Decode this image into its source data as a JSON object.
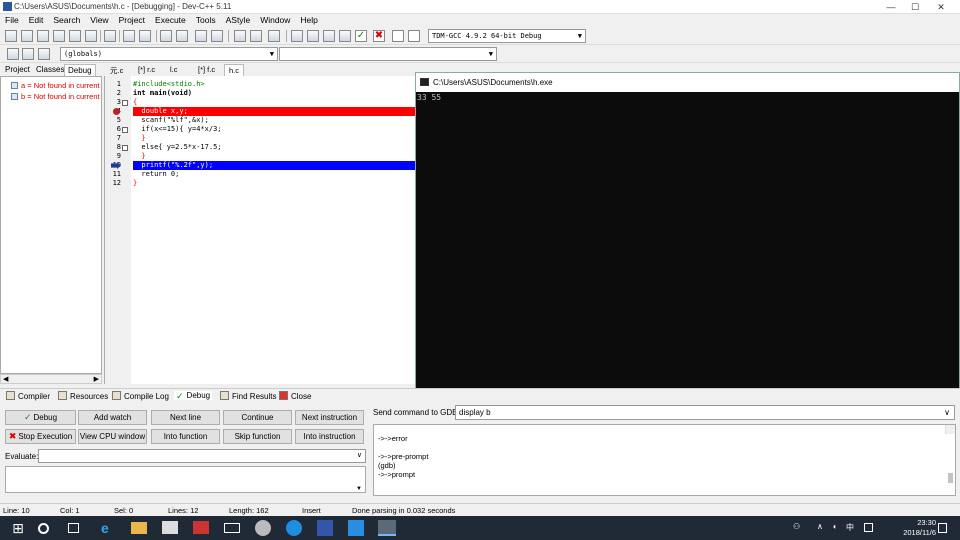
{
  "window": {
    "title": "C:\\Users\\ASUS\\Documents\\h.c - [Debugging] - Dev-C++ 5.11",
    "minimize": "—",
    "maximize": "☐",
    "close": "✕"
  },
  "menu": [
    "File",
    "Edit",
    "Search",
    "View",
    "Project",
    "Execute",
    "Tools",
    "AStyle",
    "Window",
    "Help"
  ],
  "toolbar": {
    "compiler_select": "TDM-GCC 4.9.2 64-bit Debug",
    "scope_select": "(globals)"
  },
  "left_tabs": [
    "Project",
    "Classes",
    "Debug"
  ],
  "watches": [
    {
      "text": "a = Not found in current context"
    },
    {
      "text": "b = Not found in current context"
    }
  ],
  "editor_tabs": [
    "元.c",
    "[*] r.c",
    "l.c",
    "[*] f.c",
    "h.c"
  ],
  "code_lines": [
    {
      "n": "1",
      "text": "#include<stdio.h>"
    },
    {
      "n": "2",
      "text": "int main(void)"
    },
    {
      "n": "3",
      "text": "{"
    },
    {
      "n": "4",
      "text": "  double x,y;"
    },
    {
      "n": "5",
      "text": "  scanf(\"%lf\",&x);"
    },
    {
      "n": "6",
      "text": "  if(x<=15){ y=4*x/3;"
    },
    {
      "n": "7",
      "text": "  }"
    },
    {
      "n": "8",
      "text": "  else{ y=2.5*x-17.5;"
    },
    {
      "n": "9",
      "text": "  }"
    },
    {
      "n": "10",
      "text": "  printf(\"%.2f\",y);"
    },
    {
      "n": "11",
      "text": "  return 0;"
    },
    {
      "n": "12",
      "text": "}"
    }
  ],
  "console": {
    "title": "C:\\Users\\ASUS\\Documents\\h.exe",
    "output": "33 55"
  },
  "bottom_tabs": [
    "Compiler",
    "Resources",
    "Compile Log",
    "Debug",
    "Find Results",
    "Close"
  ],
  "debug_buttons": {
    "row1": [
      "Debug",
      "Add watch",
      "Next line",
      "Continue",
      "Next instruction"
    ],
    "row2": [
      "Stop Execution",
      "View CPU window",
      "Into function",
      "Skip function",
      "Into instruction"
    ]
  },
  "evaluate_label": "Evaluate:",
  "gdb": {
    "label": "Send command to GDB:",
    "command": "display b",
    "output": [
      "->->error",
      "",
      "->->pre-prompt",
      "(gdb)",
      "->->prompt"
    ]
  },
  "status": {
    "line": "Line:   10",
    "col": "Col:   1",
    "sel": "Sel:   0",
    "lines": "Lines:   12",
    "length": "Length:   162",
    "mode": "Insert",
    "message": "Done parsing in 0.032 seconds"
  },
  "taskbar": {
    "time": "23:30",
    "date": "2018/11/6",
    "ime": "中",
    "tray_up": "∧"
  }
}
